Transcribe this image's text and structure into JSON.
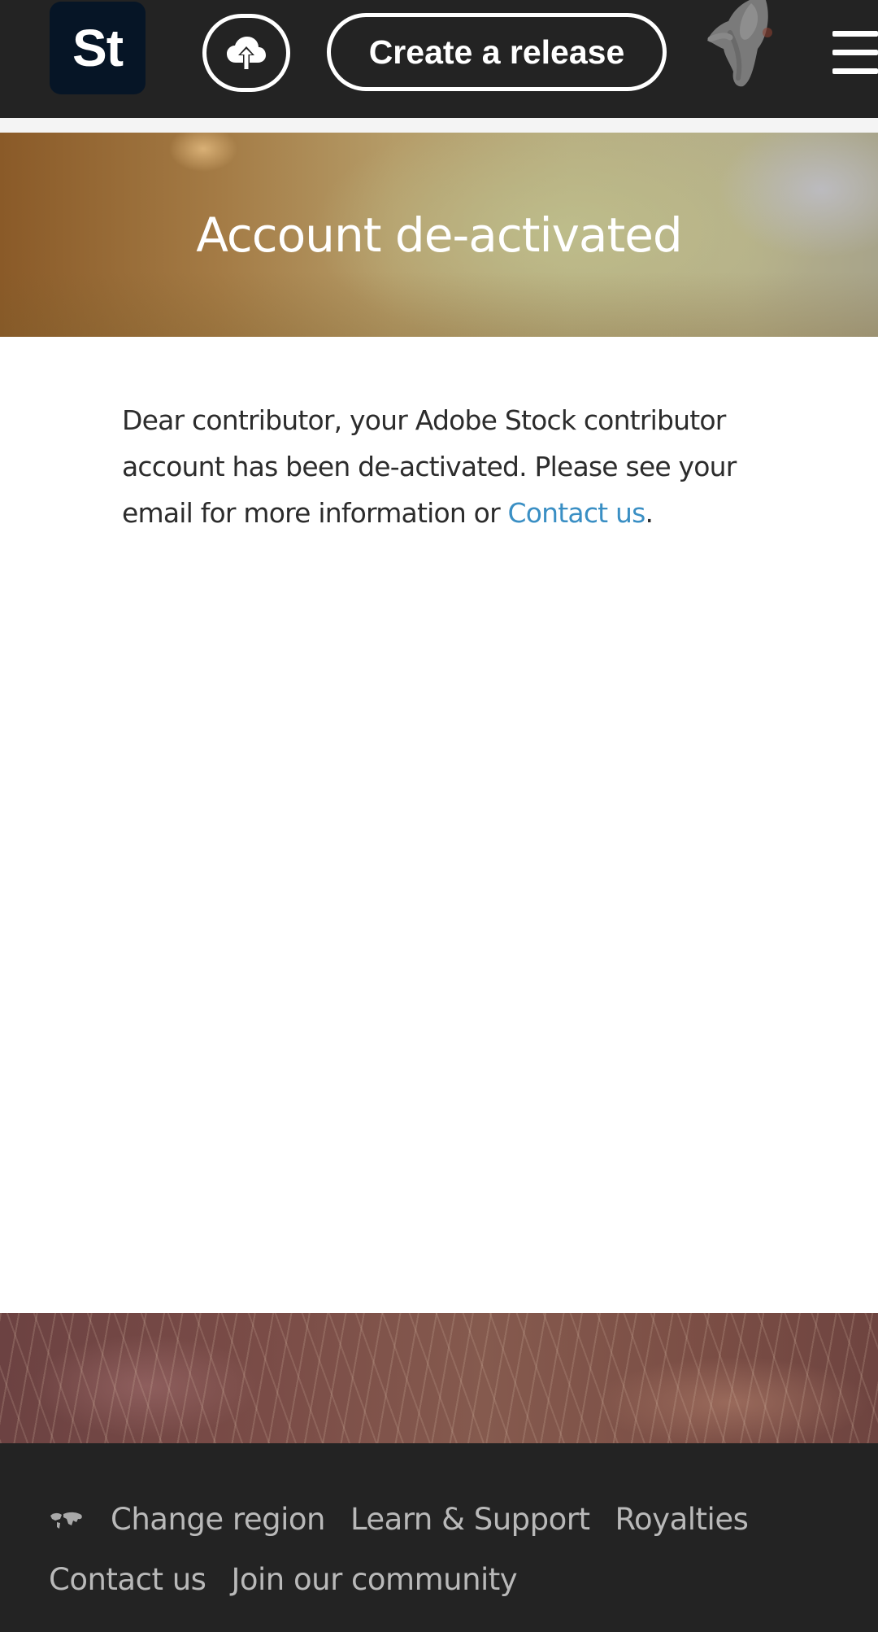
{
  "header": {
    "logo_text": "St",
    "upload_icon": "cloud-upload-icon",
    "create_release_label": "Create a release",
    "avatar_icon": "avatar",
    "menu_icon": "hamburger-menu-icon"
  },
  "hero": {
    "title": "Account de-activated"
  },
  "message": {
    "text": "Dear contributor, your Adobe Stock contributor account has been de-activated. Please see your email for more information or ",
    "link_label": "Contact us",
    "trailing": "."
  },
  "footer": {
    "region_icon": "globe-icon",
    "links": [
      {
        "label": "Change region"
      },
      {
        "label": "Learn & Support"
      },
      {
        "label": "Royalties"
      },
      {
        "label": "Contact us"
      },
      {
        "label": "Join our community"
      }
    ]
  },
  "colors": {
    "header_bg": "#232323",
    "logo_bg": "#061526",
    "link": "#3a8fc4",
    "footer_text": "#b9b9b9"
  }
}
